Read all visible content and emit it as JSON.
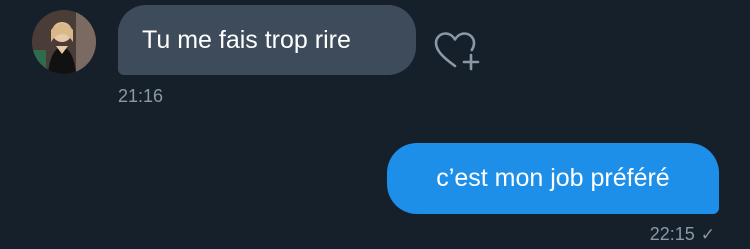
{
  "colors": {
    "background": "#15202b",
    "incoming_bubble": "#3e4b5a",
    "outgoing_bubble": "#1d8fe8",
    "timestamp": "#8b98a5"
  },
  "messages": [
    {
      "direction": "incoming",
      "text": "Tu me fais trop rire",
      "time": "21:16",
      "avatar_icon": "user-avatar",
      "reaction_icon": "heart-plus-icon"
    },
    {
      "direction": "outgoing",
      "text": "c’est mon job préféré",
      "time": "22:15",
      "status_icon": "check-icon",
      "status_glyph": "✓"
    }
  ]
}
